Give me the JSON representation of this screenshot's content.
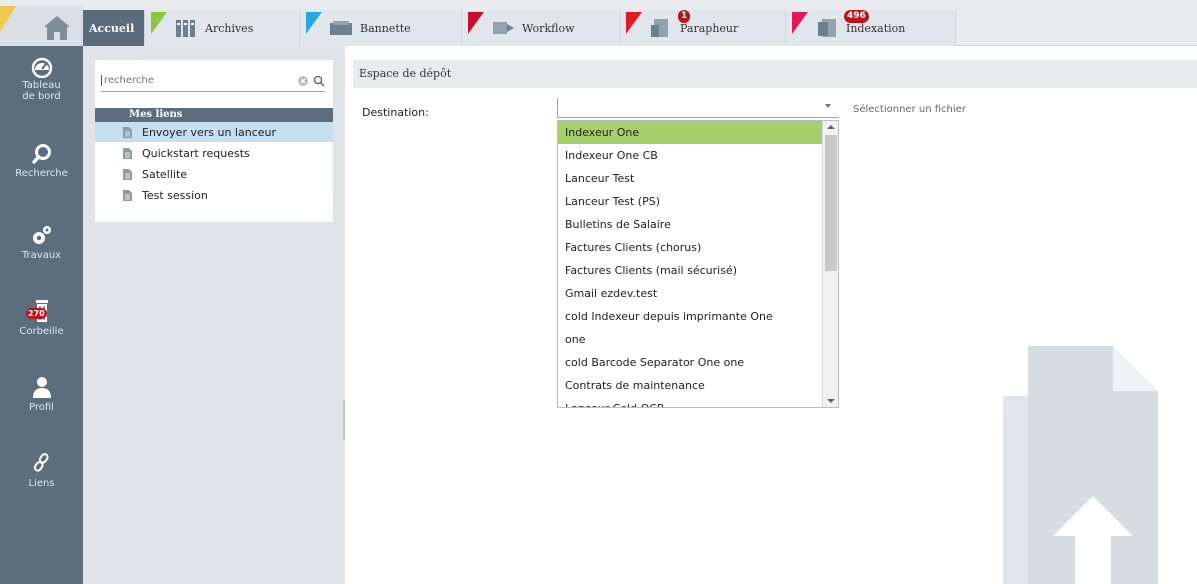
{
  "topbar": {
    "tabs": [
      {
        "label": "Accueil",
        "icon": "home-icon",
        "flag_color": "#f2c94c",
        "active": true,
        "badge": ""
      },
      {
        "label": "Archives",
        "icon": "archives-icon",
        "flag_color": "#8cc63f",
        "active": false,
        "badge": ""
      },
      {
        "label": "Bannette",
        "icon": "tray-icon",
        "flag_color": "#29a8e0",
        "active": false,
        "badge": ""
      },
      {
        "label": "Workflow",
        "icon": "workflow-icon",
        "flag_color": "#c8102e",
        "active": false,
        "badge": ""
      },
      {
        "label": "Parapheur",
        "icon": "parapheur-icon",
        "flag_color": "#e01b24",
        "active": false,
        "badge": "1"
      },
      {
        "label": "Indexation",
        "icon": "indexation-icon",
        "flag_color": "#e0195a",
        "active": false,
        "badge": "496"
      }
    ]
  },
  "rail": {
    "items": [
      {
        "label_line1": "Tableau",
        "label_line2": "de bord",
        "icon": "dashboard-icon"
      },
      {
        "label_line1": "Recherche",
        "label_line2": "",
        "icon": "search-icon"
      },
      {
        "label_line1": "Travaux",
        "label_line2": "",
        "icon": "gears-icon"
      },
      {
        "label_line1": "Corbeille",
        "label_line2": "",
        "icon": "trash-icon",
        "badge": "270"
      },
      {
        "label_line1": "Profil",
        "label_line2": "",
        "icon": "user-icon"
      },
      {
        "label_line1": "Liens",
        "label_line2": "",
        "icon": "link-icon"
      }
    ]
  },
  "links": {
    "search_placeholder": "recherche",
    "header": "Mes liens",
    "items": [
      "Envoyer vers un lanceur",
      "Quickstart requests",
      "Satellite",
      "Test session"
    ],
    "selected_index": 0
  },
  "main": {
    "section_title": "Espace de dépôt",
    "destination_label": "Destination:",
    "destination_value": "",
    "file_button": "Sélectionner un fichier",
    "options": [
      "Indexeur One",
      "Indexeur One CB",
      "Lanceur Test",
      "Lanceur Test (PS)",
      "Bulletins de Salaire",
      "Factures Clients (chorus)",
      "Factures Clients (mail sécurisé)",
      "Gmail ezdev.test",
      "cold Indexeur depuis imprimante One",
      "one",
      "cold Barcode Separator One one",
      "Contrats de maintenance",
      "Lanceur Cold OCR"
    ],
    "highlighted_index": 0
  }
}
